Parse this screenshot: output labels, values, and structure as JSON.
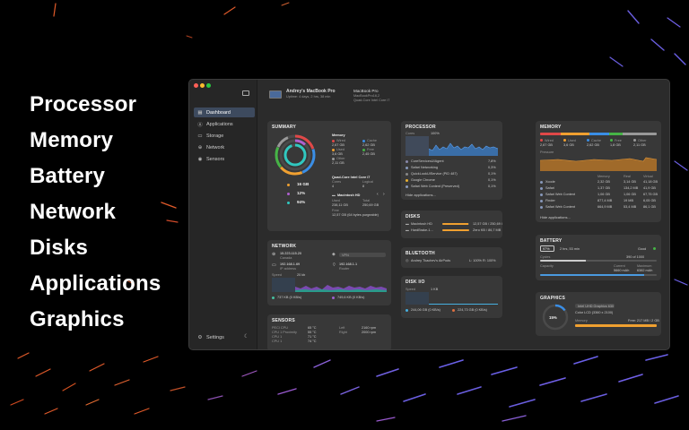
{
  "features": [
    "Processor",
    "Memory",
    "Battery",
    "Network",
    "Disks",
    "Applications",
    "Graphics"
  ],
  "sidebar": {
    "items": [
      {
        "label": "Dashboard",
        "icon": "grid-icon",
        "active": true
      },
      {
        "label": "Applications",
        "icon": "apps-icon",
        "active": false
      },
      {
        "label": "Storage",
        "icon": "storage-icon",
        "active": false
      },
      {
        "label": "Network",
        "icon": "globe-icon",
        "active": false
      },
      {
        "label": "Sensors",
        "icon": "sensor-icon",
        "active": false
      }
    ],
    "settings_label": "Settings"
  },
  "device": {
    "name": "Andrey's MacBook Pro",
    "uptime": "Uptime: 4 days, 2 hrs, 38 min",
    "model": "MacBook Pro",
    "model_id": "MacBookPro16,2",
    "cpu": "Quad-Core Intel Core i7"
  },
  "summary": {
    "title": "SUMMARY",
    "memory_title": "Memory",
    "mem": [
      {
        "label": "Wired",
        "value": "2,67 GB",
        "color": "#e04848"
      },
      {
        "label": "Cache",
        "value": "2,62 GB",
        "color": "#3a8ee6"
      },
      {
        "label": "Used",
        "value": "3,6 GB",
        "color": "#f0a030"
      },
      {
        "label": "Free",
        "value": "2,45 GB",
        "color": "#46b446"
      },
      {
        "label": "Other",
        "value": "2,11 GB",
        "color": "#999999"
      }
    ],
    "cpu_name": "Quad-Core Intel Core i7",
    "cores_label": "Cores",
    "cores": "4",
    "logical_label": "Logical",
    "logical": "8",
    "ram": "16 GB",
    "cpu_pct": "12%",
    "disk_pct": "94%",
    "disk_name": "Macintosh HD",
    "used_label": "Used",
    "used": "238,11 GB",
    "total_label": "Total",
    "total": "250,69 GB",
    "free_label": "Free",
    "free": "12,57 GB (64 bytes purgeable)"
  },
  "processor": {
    "title": "PROCESSOR",
    "cores_label": "Cores",
    "pct_label": "100%",
    "apps": [
      {
        "name": "CoreServicesUIAgent",
        "value": "7,8%",
        "color": "#8888aa"
      },
      {
        "name": "Safari Networking",
        "value": "0,3%",
        "color": "#8899bb"
      },
      {
        "name": "QuickLookUIService (PID 487)",
        "value": "0,1%",
        "color": "#888888"
      },
      {
        "name": "Google Chrome",
        "value": "0,1%",
        "color": "#e8b030"
      },
      {
        "name": "Safari Web Content (Preserved)",
        "value": "0,1%",
        "color": "#8899bb"
      }
    ],
    "hide_label": "Hide applications..."
  },
  "memory": {
    "title": "MEMORY",
    "legend": [
      {
        "label": "Wired",
        "value": "2,67 GB",
        "color": "#e04848",
        "fraction": 0.18
      },
      {
        "label": "Used",
        "value": "3,6 GB",
        "color": "#f0a030",
        "fraction": 0.24
      },
      {
        "label": "Cache",
        "value": "2,62 GB",
        "color": "#3a8ee6",
        "fraction": 0.17
      },
      {
        "label": "Free",
        "value": "1,8 GB",
        "color": "#46b446",
        "fraction": 0.12
      },
      {
        "label": "Other",
        "value": "2,11 GB",
        "color": "#999999",
        "fraction": 0.29
      }
    ],
    "pressure_label": "Pressure",
    "col_memory": "Memory",
    "col_real": "Real",
    "col_virtual": "Virtual",
    "apps": [
      {
        "name": "Xcode",
        "memory": "2,32 GB",
        "real": "3,14 GB",
        "virtual": "41,18 GB"
      },
      {
        "name": "Safari",
        "memory": "1,37 GB",
        "real": "134,2 MB",
        "virtual": "41,9 GB"
      },
      {
        "name": "Safari Web Content",
        "memory": "1,06 GB",
        "real": "1,06 GB",
        "virtual": "67,75 GB"
      },
      {
        "name": "Finder",
        "memory": "877,4 MB",
        "real": "19 MB",
        "virtual": "6,05 GB"
      },
      {
        "name": "Safari Web Content",
        "memory": "664,9 MB",
        "real": "53,4 MB",
        "virtual": "86,1 GB"
      }
    ],
    "hide_label": "Hide applications..."
  },
  "disks": {
    "title": "DISKS",
    "items": [
      {
        "name": "Macintosh HD",
        "value": "12,57 GB / 250,69 GB",
        "fraction": 0.95
      },
      {
        "name": "HardBrake-1...",
        "value": "Zero KB / 86,7 MB",
        "fraction": 0.99
      }
    ]
  },
  "battery": {
    "title": "BATTERY",
    "percent": "97%",
    "time": "2 hrs, 53 min",
    "condition": "Good",
    "condition_color": "#46b446",
    "cycles_label": "Cycles",
    "cycles": "390 of 1000",
    "cycles_fraction": 0.39,
    "capacity_label": "Capacity",
    "current_label": "Current",
    "current": "5660 mAh",
    "max_label": "Maximum",
    "max": "6382 mAh",
    "capacity_fraction": 0.89
  },
  "network": {
    "title": "NETWORK",
    "public_ip": "15.223.115.20",
    "public_label": "Canada",
    "vpn_label": "VPN",
    "local_ip": "192.168.1.69",
    "local_label": "IP address",
    "router_ip": "192.168.1.1",
    "router_label": "Router",
    "speed_label": "Speed",
    "speed_scale": "20 kb",
    "up": "737 KB (0 KB/s)",
    "down": "749,6 KB (0 KB/s)"
  },
  "bluetooth": {
    "title": "BLUETOOTH",
    "device": "Andrey Tkachev's AirPods",
    "battery": "L: 100% R: 100%"
  },
  "disk_io": {
    "title": "DISK I/O",
    "speed_label": "Speed",
    "scale": "1 KB",
    "read": "244,06 GB (0 KB/s)",
    "write": "224,73 GB (0 KB/s)"
  },
  "graphics": {
    "title": "GRAPHICS",
    "gpu_name": "Intel UHD Graphics 630",
    "display": "Color LCD (3360 x 2100)",
    "percent": "15%",
    "fraction": 0.15,
    "memory_label": "Memory",
    "memory_free": "Free: 217 MB / 2 GB"
  },
  "sensors": {
    "title": "SENSORS",
    "left": [
      {
        "name": "PECI CPU",
        "value": "65 °C"
      },
      {
        "name": "CPU 1 Proximity",
        "value": "55 °C"
      },
      {
        "name": "CPU 1",
        "value": "71 °C"
      },
      {
        "name": "CPU 1",
        "value": "74 °C"
      }
    ],
    "fans": [
      {
        "name": "Left",
        "value": "2160 rpm"
      },
      {
        "name": "Right",
        "value": "2000 rpm"
      }
    ]
  }
}
